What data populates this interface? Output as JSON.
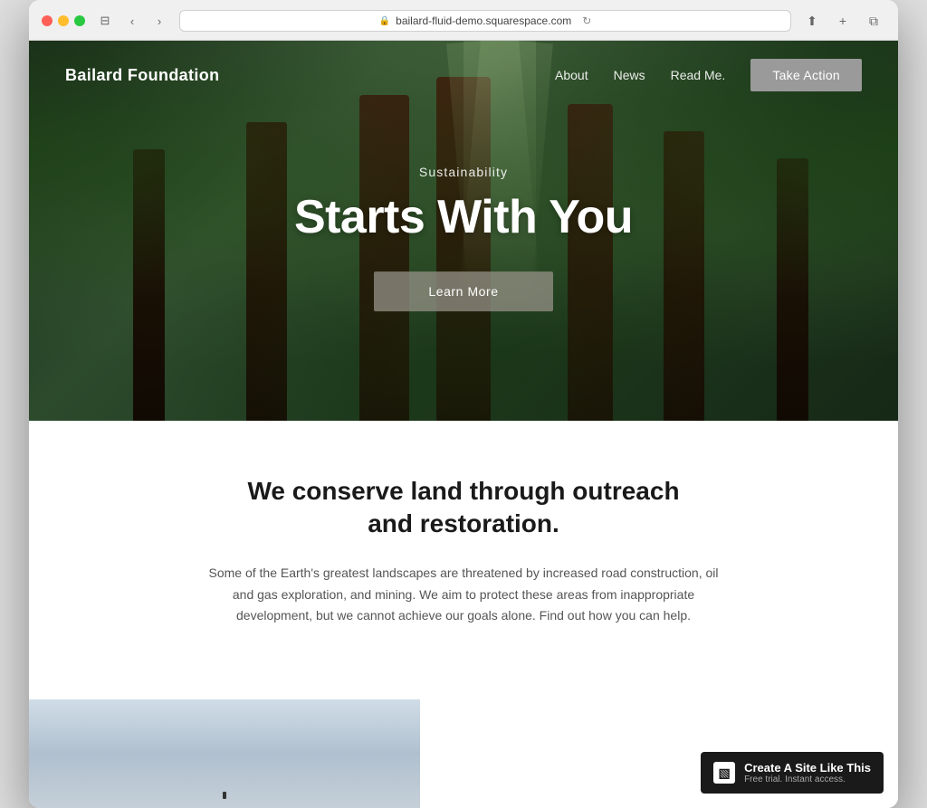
{
  "browser": {
    "url": "bailard-fluid-demo.squarespace.com",
    "back_btn": "‹",
    "forward_btn": "›",
    "refresh_btn": "↻"
  },
  "navbar": {
    "logo": "Bailard Foundation",
    "links": [
      {
        "label": "About"
      },
      {
        "label": "News"
      },
      {
        "label": "Read Me."
      }
    ],
    "cta": "Take Action"
  },
  "hero": {
    "subtitle": "Sustainability",
    "title": "Starts With You",
    "button": "Learn More"
  },
  "content": {
    "heading": "We conserve land through outreach and restoration.",
    "body": "Some of the Earth's greatest landscapes are threatened by increased road construction, oil and gas exploration, and mining. We aim to protect these areas from inappropriate development, but we cannot achieve our goals alone. Find out how you can help."
  },
  "badge": {
    "title": "Create A Site Like This",
    "subtitle": "Free trial. Instant access."
  }
}
